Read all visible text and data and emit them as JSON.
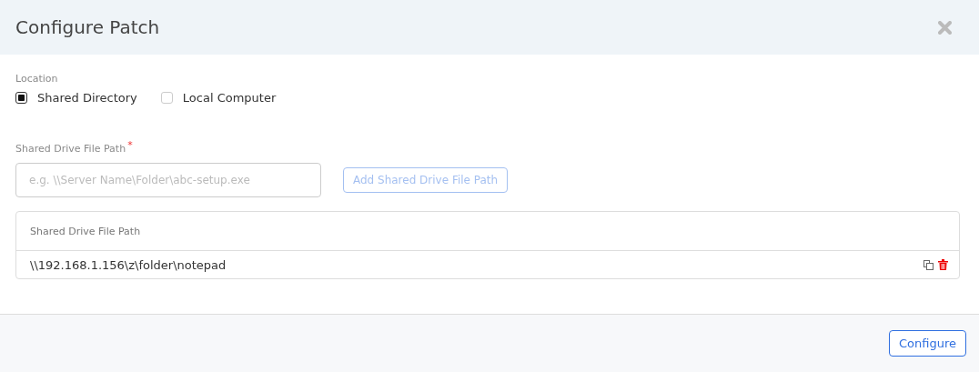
{
  "dialog": {
    "title": "Configure Patch"
  },
  "location": {
    "label": "Location",
    "options": [
      {
        "label": "Shared Directory",
        "selected": true
      },
      {
        "label": "Local Computer",
        "selected": false
      }
    ]
  },
  "path_field": {
    "label": "Shared Drive File Path",
    "required_mark": "*",
    "placeholder": "e.g. \\\\Server Name\\Folder\\abc-setup.exe"
  },
  "add_button": {
    "label": "Add Shared Drive File Path",
    "disabled": true
  },
  "table": {
    "columns": [
      "Shared Drive File Path"
    ],
    "rows": [
      {
        "cells": [
          "\\\\192.168.1.156\\z\\folder\\notepad"
        ]
      }
    ]
  },
  "buttons": [
    {
      "label": "Configure"
    }
  ]
}
